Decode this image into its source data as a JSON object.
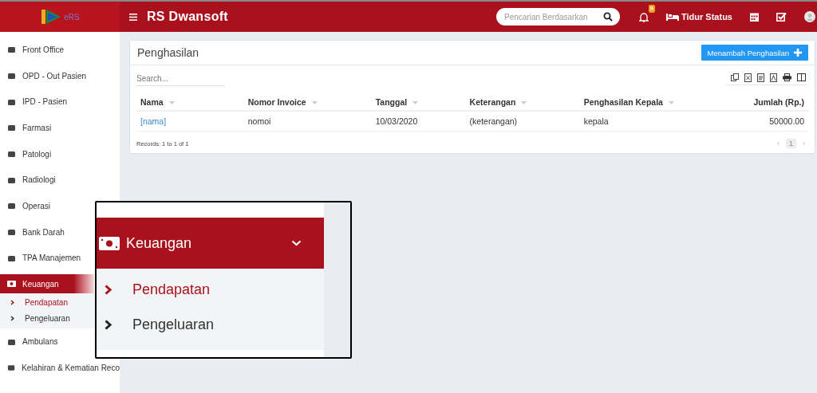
{
  "header": {
    "logo_text": "eRS",
    "title": "RS Dwansoft",
    "search": {
      "placeholder": "Pencarian Berdasarkan"
    },
    "notification_count": "9",
    "bed_status": "Tidur Status"
  },
  "sidebar": {
    "items": [
      {
        "label": "Front Office",
        "selected": false
      },
      {
        "label": "OPD - Out Pasien",
        "selected": false
      },
      {
        "label": "IPD - Pasien",
        "selected": false
      },
      {
        "label": "Farmasi",
        "selected": false
      },
      {
        "label": "Patologi",
        "selected": false
      },
      {
        "label": "Radiologi",
        "selected": false
      },
      {
        "label": "Operasi",
        "selected": false
      },
      {
        "label": "Bank Darah",
        "selected": false
      },
      {
        "label": "TPA Manajemen",
        "selected": false
      },
      {
        "label": "Keuangan",
        "selected": true,
        "expanded": true,
        "children": [
          {
            "label": "Pendapatan",
            "selected": true
          },
          {
            "label": "Pengeluaran",
            "selected": false
          }
        ]
      },
      {
        "label": "Ambulans",
        "selected": false
      },
      {
        "label": "Kelahiran & Kematian Reco",
        "selected": false
      }
    ]
  },
  "card": {
    "title": "Penghasilan",
    "add_button": "Menambah Penghasilan",
    "search": {
      "placeholder": "Search..."
    },
    "table": {
      "columns": [
        {
          "label": "Nama",
          "sortable": true
        },
        {
          "label": "Nomor Invoice",
          "sortable": true
        },
        {
          "label": "Tanggal",
          "sortable": true
        },
        {
          "label": "Keterangan",
          "sortable": true
        },
        {
          "label": "Penghasilan Kepala",
          "sortable": true
        },
        {
          "label": "Jumlah (Rp.)",
          "sortable": false
        }
      ],
      "rows": [
        [
          "[nama]",
          "nomoi",
          "10/03/2020",
          "(keterangan)",
          "kepala",
          "50000.00"
        ]
      ]
    },
    "records": "Records: 1 to 1 of 1",
    "pagination": {
      "prev": "‹",
      "pages": [
        {
          "label": "1",
          "selected": true
        }
      ],
      "next": "›"
    }
  },
  "callout": {
    "title": "Keuangan",
    "expanded": true,
    "items": [
      {
        "label": "Pendapatan",
        "selected": true
      },
      {
        "label": "Pengeluaran",
        "selected": false
      }
    ]
  }
}
